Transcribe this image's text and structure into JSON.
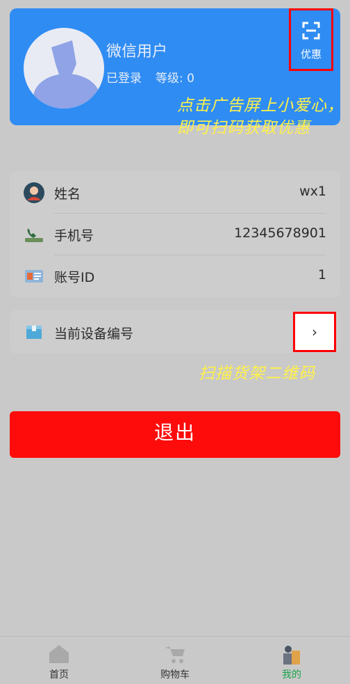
{
  "profile": {
    "username": "微信用户",
    "login_status": "已登录",
    "level_text": "等级: 0",
    "scan_button_label": "优惠"
  },
  "annotations": {
    "scan_hint": "点击广告屏上小爱心，即可扫码获取优惠",
    "device_hint": "扫描货架二维码"
  },
  "info": {
    "rows": [
      {
        "label": "姓名",
        "value": "wx1",
        "icon": "user-avatar-icon"
      },
      {
        "label": "手机号",
        "value": "12345678901",
        "icon": "phone-icon"
      },
      {
        "label": "账号ID",
        "value": "1",
        "icon": "id-card-icon"
      }
    ]
  },
  "device": {
    "label": "当前设备编号",
    "icon": "box-icon",
    "chevron": "›"
  },
  "actions": {
    "logout_label": "退出"
  },
  "tabbar": {
    "items": [
      {
        "label": "首页",
        "icon": "home-icon",
        "active": false
      },
      {
        "label": "购物车",
        "icon": "cart-icon",
        "active": false
      },
      {
        "label": "我的",
        "icon": "profile-icon",
        "active": true
      }
    ]
  },
  "colors": {
    "profile_bg": "#2f8cf3",
    "page_bg": "#c9c9c9",
    "logout_bg": "#fe0c0c",
    "highlight_border": "#ff0000",
    "annotation_text": "#fff14a",
    "active_tab": "#1aa34a"
  }
}
